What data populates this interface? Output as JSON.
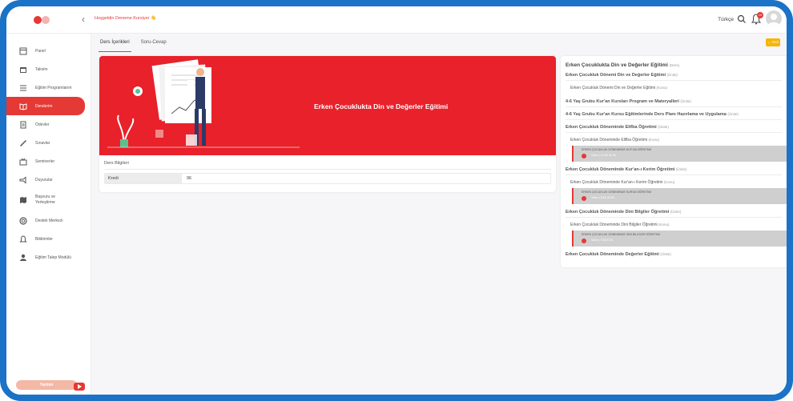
{
  "header": {
    "welcome": "Hoşgeldin Deneme Kursiyer 👋",
    "language": "Türkçe",
    "notification_count": "10"
  },
  "sidebar": {
    "items": [
      {
        "label": "Panel",
        "icon": "panel-icon"
      },
      {
        "label": "Takvim",
        "icon": "calendar-icon"
      },
      {
        "label": "Eğitim Programlarım",
        "icon": "list-icon"
      },
      {
        "label": "Derslerim",
        "icon": "book-icon",
        "active": true
      },
      {
        "label": "Ödevler",
        "icon": "document-icon"
      },
      {
        "label": "Sınavlar",
        "icon": "pencil-icon"
      },
      {
        "label": "Seminerler",
        "icon": "tv-icon"
      },
      {
        "label": "Duyurular",
        "icon": "megaphone-icon"
      },
      {
        "label": "Başvuru ve Yerleştirme",
        "icon": "map-icon"
      },
      {
        "label": "Destek Merkezi",
        "icon": "support-icon"
      },
      {
        "label": "Bildirimler",
        "icon": "bell-icon"
      },
      {
        "label": "Eğitim Talep Modülü",
        "icon": "user-icon"
      }
    ],
    "help_label": "Yardım"
  },
  "tabs": [
    {
      "label": "Ders İçerikleri",
      "active": true
    },
    {
      "label": "Soru-Cevap",
      "active": false
    }
  ],
  "back_button": "← Geri",
  "course": {
    "title": "Erken Çocuklukta Din ve Değerler Eğitimi",
    "info_heading": "Ders Bilgileri",
    "info_rows": [
      {
        "key": "Kredi",
        "value": "96"
      }
    ]
  },
  "outline": {
    "title": "Erken Çocuklukta Din ve Değerler Eğitimi",
    "title_tag": "(Ders)",
    "items": [
      {
        "label": "Erken Çocukluk Dönemi Din ve Değerler Eğitimi",
        "tag": "(Ünite)",
        "type": "unit"
      },
      {
        "label": "Erken Çocukluk Dönemi Din ve Değerler Eğitimi",
        "tag": "(Konu)",
        "type": "konu"
      },
      {
        "label": "4-6 Yaş Grubu Kur'an Kursları Program ve Materyalleri",
        "tag": "(Ünite)",
        "type": "unit"
      },
      {
        "label": "4-6 Yaş Grubu Kur'an Kursu Eğitimlerinde Ders Planı Hazırlama ve Uygulama",
        "tag": "(Ünite)",
        "type": "unit"
      },
      {
        "label": "Erken Çocukluk Döneminde Elifba Öğretimi",
        "tag": "(Ünite)",
        "type": "unit"
      },
      {
        "label": "Erken Çocukluk Döneminde Elifba Öğretimi",
        "tag": "(Konu)",
        "type": "konu"
      },
      {
        "label": "ERKEN ÇOCUKLUK DÖNEMİNDE ELİF-BA ÖĞRETİMİ",
        "sub": "Video | 10 Dk 30 Sn",
        "type": "video"
      },
      {
        "label": "Erken Çocukluk Döneminde Kur'an-ı Kerim Öğretimi",
        "tag": "(Ünite)",
        "type": "unit"
      },
      {
        "label": "Erken Çocukluk Döneminde Kur'an-ı Kerim Öğretimi",
        "tag": "(Konu)",
        "type": "konu"
      },
      {
        "label": "ERKEN ÇOCUKLUK DÖNEMİNDE KUR'AN ÖĞRETİMİ",
        "sub": "Video | 8 Dk 40 Sn",
        "type": "video"
      },
      {
        "label": "Erken Çocukluk Döneminde Dini Bilgiler Öğretimi",
        "tag": "(Ünite)",
        "type": "unit"
      },
      {
        "label": "Erken Çocukluk Döneminde Dini Bilgiler Öğretimi",
        "tag": "(Konu)",
        "type": "konu"
      },
      {
        "label": "ERKEN ÇOCUKLUK DÖNEMİNDE DİNİ BİLGİLER ÖĞRETİMİ",
        "sub": "Video | 9 Dk 8 Sn",
        "type": "video"
      },
      {
        "label": "Erken Çocukluk Döneminde Değerler Eğitimi",
        "tag": "(Ünite)",
        "type": "unit"
      }
    ]
  },
  "colors": {
    "brand": "#e53935",
    "frame": "#1a73c7",
    "back": "#f7b500"
  }
}
